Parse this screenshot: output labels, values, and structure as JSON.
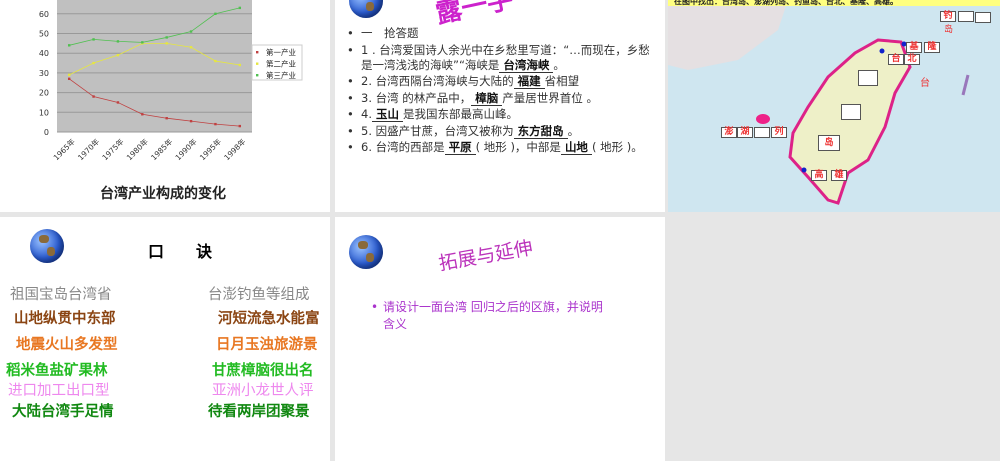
{
  "slide1": {
    "title": "台湾产业构成的变化"
  },
  "chart_data": {
    "type": "line",
    "title": "台湾产业构成的变化",
    "xlabel": "",
    "ylabel": "",
    "categories": [
      "1965年",
      "1970年",
      "1975年",
      "1980年",
      "1985年",
      "1990年",
      "1995年",
      "1998年"
    ],
    "yticks": [
      0,
      10,
      20,
      30,
      40,
      50,
      60
    ],
    "ylim": [
      0,
      67
    ],
    "grid": true,
    "legend": "right",
    "series": [
      {
        "name": "第一产业",
        "color": "#c04040",
        "values": [
          27,
          18,
          15,
          9,
          7,
          5.5,
          4,
          3
        ]
      },
      {
        "name": "第二产业",
        "color": "#e6e640",
        "values": [
          29,
          35,
          39,
          45,
          45,
          43,
          36,
          34
        ]
      },
      {
        "name": "第三产业",
        "color": "#50c050",
        "values": [
          44,
          47,
          46,
          45.5,
          48,
          51,
          60,
          63
        ]
      }
    ]
  },
  "slide2": {
    "title": "露一手",
    "items": [
      {
        "text": "一　抢答题"
      },
      {
        "pre": "1 . 台湾爱国诗人余光中在乡愁里写道：“…而现在，乡愁是一湾浅浅的海峡”“海峡是",
        "answer": "台湾海峡",
        "post": "。"
      },
      {
        "pre": "2. 台湾西隔台湾海峡与大陆的",
        "answer": "福建",
        "post": "省相望"
      },
      {
        "pre": "3. 台湾 的林产品中，",
        "answer": "樟脑",
        "post": "产量居世界首位 。"
      },
      {
        "pre": "4.",
        "answer": "玉山",
        "post": "是我国东部最高山峰。"
      },
      {
        "pre": "5. 因盛产甘蔗，台湾又被称为",
        "answer": "东方甜岛",
        "post": "。"
      },
      {
        "pre": "6. 台湾的西部是",
        "answer": "平原",
        "mid": "( 地形 )，中部是",
        "answer2": "山地",
        "post": "( 地形 )。"
      }
    ]
  },
  "slide3": {
    "header": "在图中找出：台湾岛、澎湖列岛、钓鱼岛、台北、基隆、高雄。",
    "labels": {
      "diao": "钓",
      "dao": "岛",
      "ji": "基",
      "long": "隆",
      "tai": "台",
      "bei": "北",
      "island": "岛",
      "peng": "澎",
      "hu": "湖",
      "lie": "列",
      "gao": "高",
      "xiong": "雄",
      "sea": "台"
    }
  },
  "slide4": {
    "title": "口　　诀",
    "verses": [
      {
        "left": "祖国宝岛台湾省",
        "right": "台澎钓鱼等组成",
        "color": "#888888"
      },
      {
        "left": "山地纵贯中东部",
        "right": "河短流急水能富",
        "color": "#8b4513"
      },
      {
        "left": "地震火山多发型",
        "right": "日月玉浊旅游景",
        "color": "#e87722"
      },
      {
        "left": "稻米鱼盐矿果林",
        "right": "甘蔗樟脑很出名",
        "color": "#22bb22"
      },
      {
        "left": "进口加工出口型",
        "right": "亚洲小龙世人评",
        "color": "#ee88ee"
      },
      {
        "left": "大陆台湾手足情",
        "right": "待看两岸团聚景",
        "color": "#118811"
      }
    ]
  },
  "slide5": {
    "title": "拓展与延伸",
    "bullet": "请设计一面台湾 回归之后的区旗，并说明含义"
  }
}
